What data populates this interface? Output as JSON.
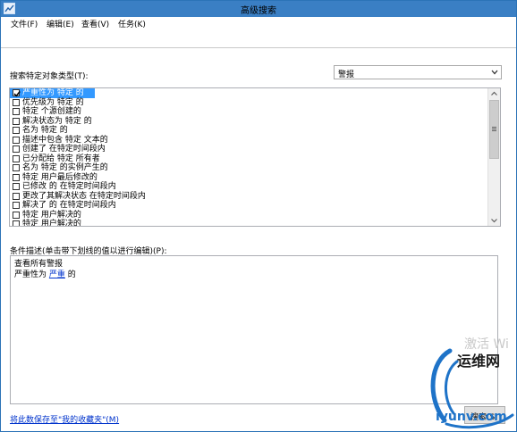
{
  "window": {
    "title": "高级搜索"
  },
  "menu": [
    {
      "label": "文件(F)"
    },
    {
      "label": "编辑(E)"
    },
    {
      "label": "查看(V)"
    },
    {
      "label": "任务(K)"
    }
  ],
  "object_type": {
    "label": "搜索特定对象类型(T):",
    "selected": "警报"
  },
  "criteria": [
    {
      "label": "严重性为 特定 的",
      "checked": true,
      "selected": true
    },
    {
      "label": "优先级为 特定 的",
      "checked": false
    },
    {
      "label": "特定 个源创建的",
      "checked": false
    },
    {
      "label": "解决状态为 特定  的",
      "checked": false
    },
    {
      "label": "名为 特定 的",
      "checked": false
    },
    {
      "label": "描述中包含 特定 文本的",
      "checked": false
    },
    {
      "label": "创建了 在特定时间段内",
      "checked": false
    },
    {
      "label": "已分配给 特定 所有者",
      "checked": false
    },
    {
      "label": "名为 特定 的实例产生的",
      "checked": false
    },
    {
      "label": "特定 用户最后修改的",
      "checked": false
    },
    {
      "label": "已修改  的 在特定时间段内",
      "checked": false
    },
    {
      "label": "更改了其解决状态 在特定时间段内",
      "checked": false
    },
    {
      "label": "解决了  的 在特定时间段内",
      "checked": false
    },
    {
      "label": "特定 用户解决的",
      "checked": false
    },
    {
      "label": "特定 用户解决的",
      "checked": false
    }
  ],
  "description": {
    "label": "条件描述(单击带下划线的值以进行编辑)(P):",
    "line1": "查看所有警报",
    "line2_prefix": "严重性为 ",
    "line2_link": "严重",
    "line2_suffix": " 的"
  },
  "save_link": "将此数保存至\"我的收藏夹\"(M)",
  "partial_button": "搜索(S",
  "overlay": {
    "activate": "激活 Wi",
    "watermark_cn": "运维网",
    "watermark_url": "iyunv.com"
  }
}
